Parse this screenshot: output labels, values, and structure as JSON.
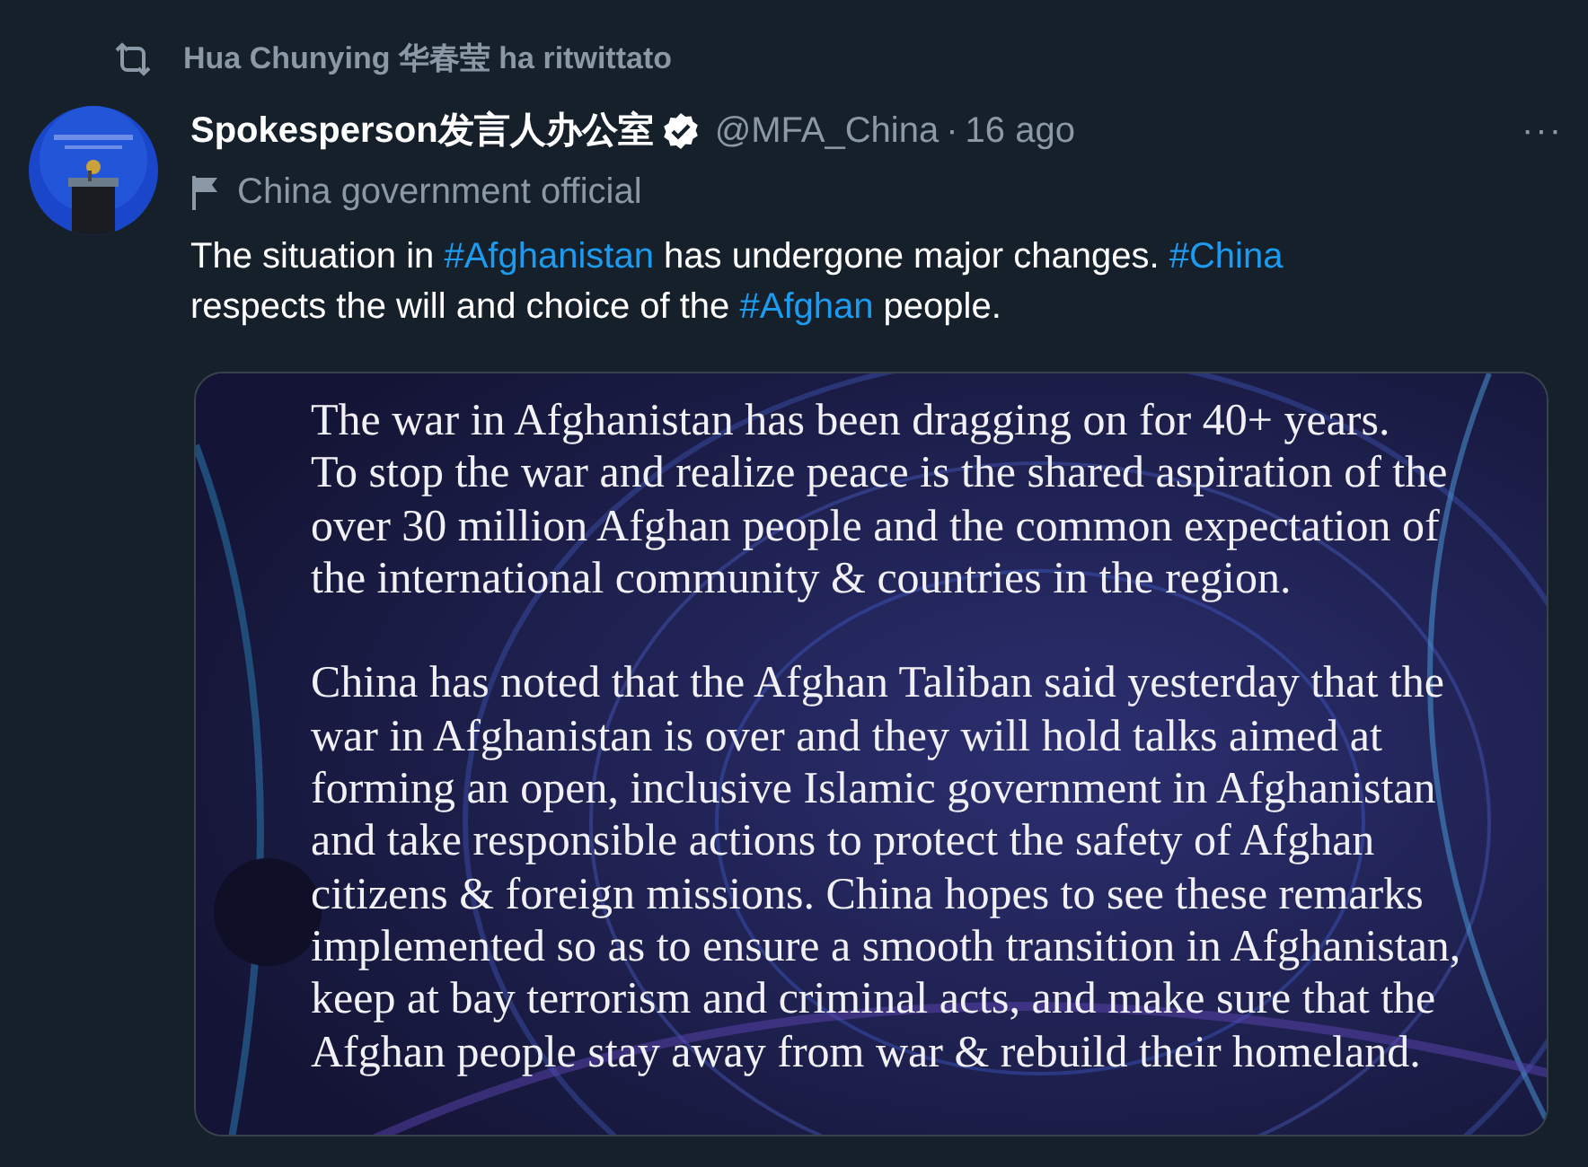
{
  "retweet": {
    "label": "Hua Chunying 华春莹 ha ritwittato"
  },
  "tweet": {
    "author": "Spokesperson发言人办公室",
    "verified": true,
    "handle": "@MFA_China",
    "separator": "·",
    "time": "16 ago",
    "more": "···",
    "label": "China government official",
    "text": [
      {
        "kind": "text",
        "text": "The situation in "
      },
      {
        "kind": "hashtag",
        "text": "#Afghanistan"
      },
      {
        "kind": "text",
        "text": " has undergone major changes. "
      },
      {
        "kind": "hashtag",
        "text": "#China"
      },
      {
        "kind": "text",
        "text": " respects the will and choice of the "
      },
      {
        "kind": "hashtag",
        "text": "#Afghan"
      },
      {
        "kind": "text",
        "text": " people."
      }
    ],
    "image": {
      "paragraphs": [
        [
          "The war in Afghanistan has been dragging on for 40+ years.",
          "To stop the war and realize peace is the shared aspiration of the",
          "over 30 million Afghan people and the common expectation of",
          "the international community & countries in the region."
        ],
        [
          "China has noted that the Afghan Taliban said yesterday that the",
          "war in Afghanistan is over and they will hold talks aimed at",
          "forming an open, inclusive Islamic government in Afghanistan",
          "and take responsible actions to protect the safety of Afghan",
          "citizens & foreign missions. China hopes to see these remarks",
          "implemented so as to ensure a smooth transition in Afghanistan,",
          "keep at bay terrorism and criminal acts, and make sure that the",
          "Afghan people stay away from war & rebuild their homeland."
        ]
      ]
    }
  }
}
